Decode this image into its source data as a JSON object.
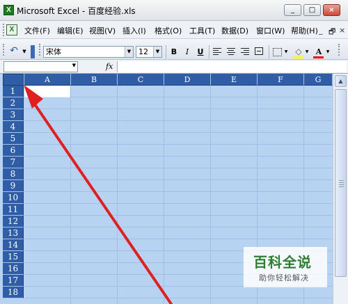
{
  "window": {
    "title": "Microsoft Excel - 百度经验.xls",
    "app_icon": "X",
    "controls": {
      "minimize": "_",
      "maximize": "□",
      "close": "×"
    }
  },
  "menubar": {
    "items": [
      "文件(F)",
      "编辑(E)",
      "视图(V)",
      "插入(I)",
      "格式(O)",
      "工具(T)",
      "数据(D)",
      "窗口(W)",
      "帮助(H)"
    ],
    "mdi_controls": {
      "minimize": "_",
      "restore": "🗗",
      "close": "×"
    }
  },
  "toolbar": {
    "font_name": "宋体",
    "font_size": "12",
    "bold": "B",
    "italic": "I",
    "underline": "U",
    "font_color_glyph": "A",
    "accent_fill": "#ffff00",
    "accent_font": "#ff0000"
  },
  "formula_bar": {
    "name_box": "",
    "fx_label": "fx",
    "formula": ""
  },
  "sheet": {
    "columns": [
      "A",
      "B",
      "C",
      "D",
      "E",
      "F",
      "G"
    ],
    "rows": [
      "1",
      "2",
      "3",
      "4",
      "5",
      "6",
      "7",
      "8",
      "9",
      "10",
      "11",
      "12",
      "13",
      "14",
      "15",
      "16",
      "17",
      "18"
    ],
    "selected_range": "all",
    "header_color": "#2f5ea7",
    "selection_color": "#b8d3f2"
  },
  "annotation": {
    "arrow_color": "#e02020"
  },
  "watermark": {
    "main": "百科全说",
    "sub": "助你轻松解决"
  }
}
